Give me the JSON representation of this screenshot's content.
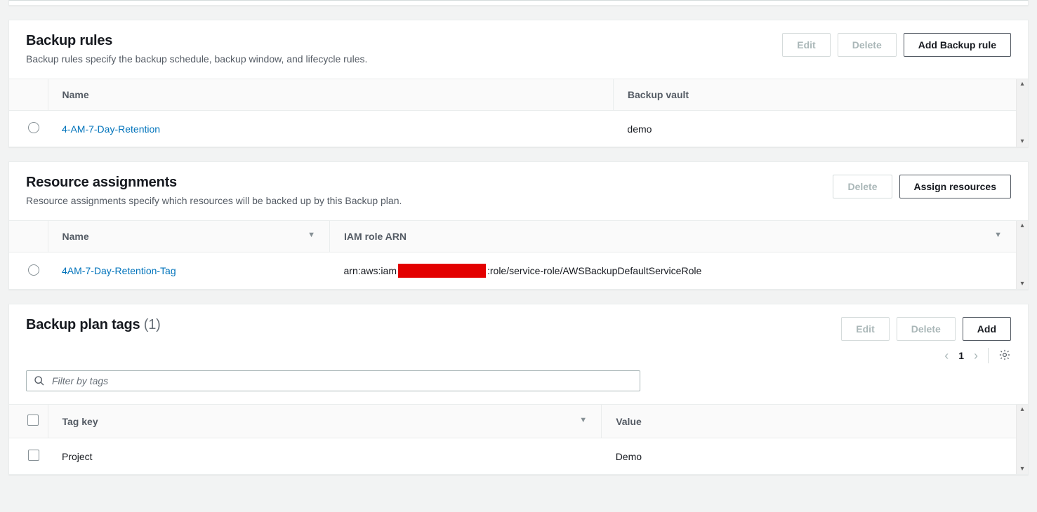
{
  "backupRules": {
    "title": "Backup rules",
    "desc": "Backup rules specify the backup schedule, backup window, and lifecycle rules.",
    "buttons": {
      "edit": "Edit",
      "delete": "Delete",
      "add": "Add Backup rule"
    },
    "columns": {
      "name": "Name",
      "vault": "Backup vault"
    },
    "rows": [
      {
        "name": "4-AM-7-Day-Retention",
        "vault": "demo"
      }
    ]
  },
  "resourceAssignments": {
    "title": "Resource assignments",
    "desc": "Resource assignments specify which resources will be backed up by this Backup plan.",
    "buttons": {
      "delete": "Delete",
      "assign": "Assign resources"
    },
    "columns": {
      "name": "Name",
      "iam": "IAM role ARN"
    },
    "rows": [
      {
        "name": "4AM-7-Day-Retention-Tag",
        "arnPrefix": "arn:aws:iam",
        "arnSuffix": ":role/service-role/AWSBackupDefaultServiceRole"
      }
    ]
  },
  "tags": {
    "title": "Backup plan tags",
    "count": "(1)",
    "buttons": {
      "edit": "Edit",
      "delete": "Delete",
      "add": "Add"
    },
    "searchPlaceholder": "Filter by tags",
    "page": "1",
    "columns": {
      "key": "Tag key",
      "value": "Value"
    },
    "rows": [
      {
        "key": "Project",
        "value": "Demo"
      }
    ]
  }
}
